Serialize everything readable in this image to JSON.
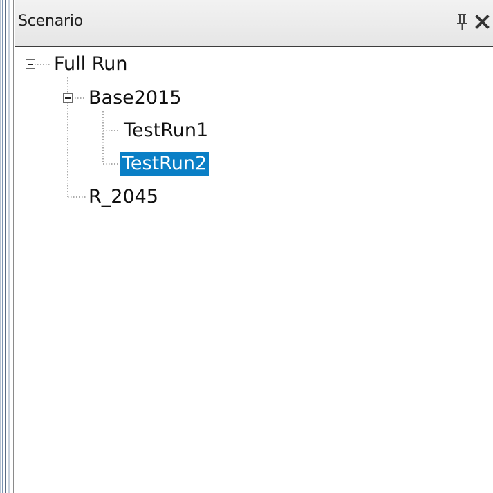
{
  "panel": {
    "title": "Scenario",
    "pin_icon": "pin-icon",
    "close_icon": "close-icon"
  },
  "tree": {
    "nodes": [
      {
        "label": "Full Run",
        "level": 0,
        "expanded": true,
        "selected": false
      },
      {
        "label": "Base2015",
        "level": 1,
        "expanded": true,
        "selected": false
      },
      {
        "label": "TestRun1",
        "level": 2,
        "selected": false
      },
      {
        "label": "TestRun2",
        "level": 2,
        "selected": true
      },
      {
        "label": "R_2045",
        "level": 1,
        "selected": false
      }
    ]
  },
  "colors": {
    "selection": "#0a7fc6",
    "header": "#ececec",
    "frame": "#7d95b4"
  }
}
